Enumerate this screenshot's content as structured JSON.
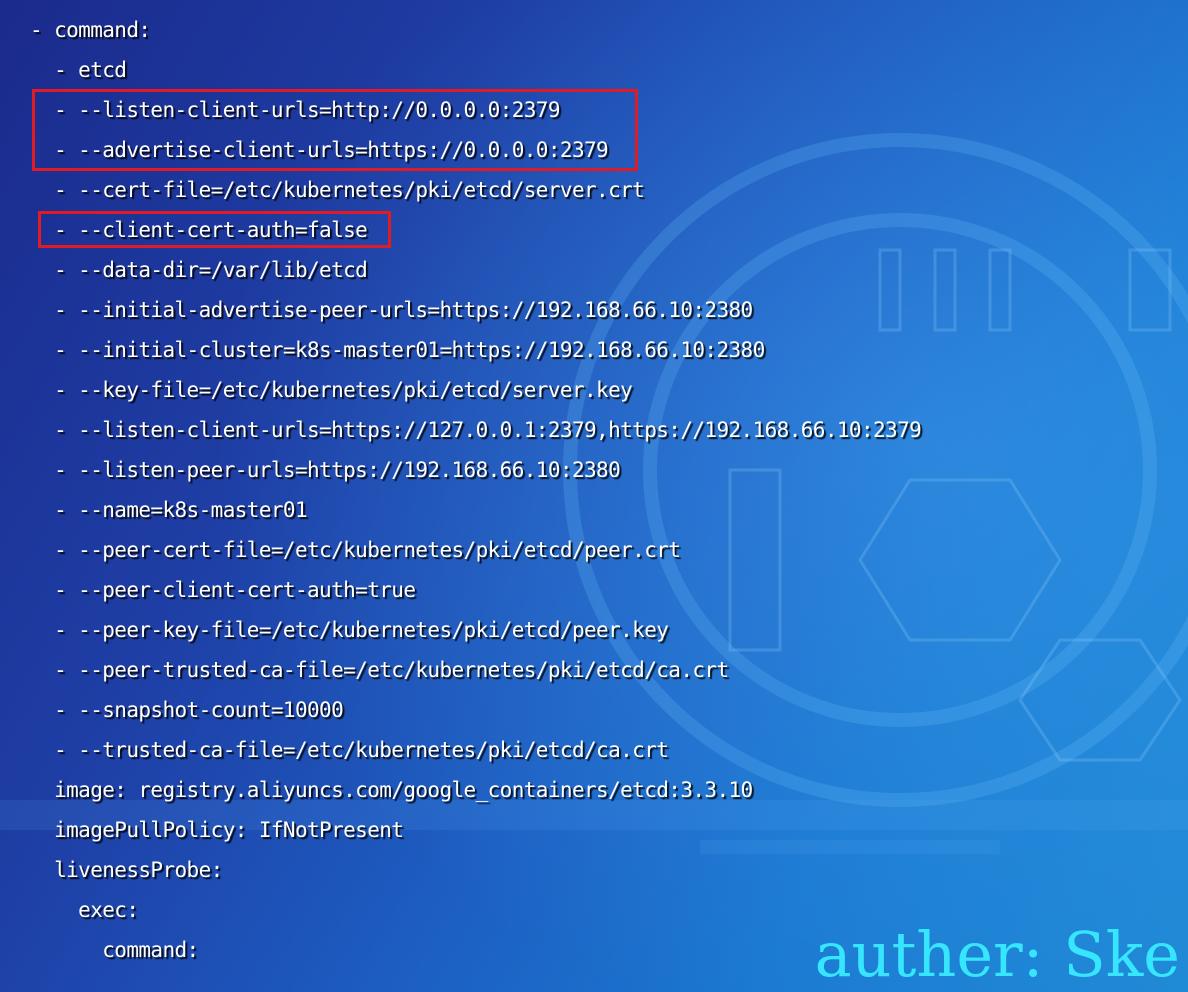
{
  "lines": [
    "- command:",
    "  - etcd",
    "  - --listen-client-urls=http://0.0.0.0:2379",
    "  - --advertise-client-urls=https://0.0.0.0:2379",
    "  - --cert-file=/etc/kubernetes/pki/etcd/server.crt",
    "  - --client-cert-auth=false",
    "  - --data-dir=/var/lib/etcd",
    "  - --initial-advertise-peer-urls=https://192.168.66.10:2380",
    "  - --initial-cluster=k8s-master01=https://192.168.66.10:2380",
    "  - --key-file=/etc/kubernetes/pki/etcd/server.key",
    "  - --listen-client-urls=https://127.0.0.1:2379,https://192.168.66.10:2379",
    "  - --listen-peer-urls=https://192.168.66.10:2380",
    "  - --name=k8s-master01",
    "  - --peer-cert-file=/etc/kubernetes/pki/etcd/peer.crt",
    "  - --peer-client-cert-auth=true",
    "  - --peer-key-file=/etc/kubernetes/pki/etcd/peer.key",
    "  - --peer-trusted-ca-file=/etc/kubernetes/pki/etcd/ca.crt",
    "  - --snapshot-count=10000",
    "  - --trusted-ca-file=/etc/kubernetes/pki/etcd/ca.crt",
    "  image: registry.aliyuncs.com/google_containers/etcd:3.3.10",
    "  imagePullPolicy: IfNotPresent",
    "  livenessProbe:",
    "    exec:",
    "      command:"
  ],
  "watermark": "auther: Ske",
  "colors": {
    "text": "#ffffff",
    "highlight_border": "#e01b24",
    "watermark": "#36e6ff",
    "background_start": "#1b2a8c",
    "background_end": "#1f8ad6"
  }
}
